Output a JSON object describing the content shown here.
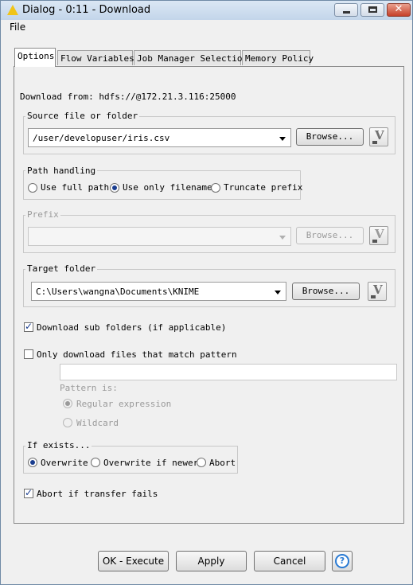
{
  "window": {
    "title": "Dialog - 0:11 - Download",
    "close_glyph": "✕"
  },
  "menu": {
    "file": "File"
  },
  "tabs": [
    "Options",
    "Flow Variables",
    "Job Manager Selection",
    "Memory Policy"
  ],
  "options": {
    "download_from": "Download from: hdfs://@172.21.3.116:25000",
    "source": {
      "legend": "Source file or folder",
      "value": "/user/developuser/iris.csv",
      "browse": "Browse..."
    },
    "path_handling": {
      "legend": "Path handling",
      "options": [
        "Use full path",
        "Use only filename",
        "Truncate prefix"
      ],
      "selected": "Use only filename"
    },
    "prefix": {
      "legend": "Prefix",
      "value": "",
      "browse": "Browse..."
    },
    "target": {
      "legend": "Target folder",
      "value": "C:\\Users\\wangna\\Documents\\KNIME",
      "browse": "Browse..."
    },
    "download_sub_folders": {
      "label": "Download sub folders (if applicable)",
      "checked": true
    },
    "match_pattern": {
      "label": "Only download files that match pattern",
      "checked": false,
      "pattern_value": "",
      "pattern_is": "Pattern is:",
      "regex": "Regular expression",
      "wildcard": "Wildcard",
      "selected": "Regular expression"
    },
    "if_exists": {
      "legend": "If exists...",
      "options": [
        "Overwrite",
        "Overwrite if newer",
        "Abort"
      ],
      "selected": "Overwrite"
    },
    "abort_if_fails": {
      "label": "Abort if transfer fails",
      "checked": true
    }
  },
  "icons": {
    "flow_variable": "V",
    "help": "?",
    "checkmark": "✓"
  },
  "buttons": {
    "ok_execute": "OK - Execute",
    "apply": "Apply",
    "cancel": "Cancel"
  }
}
